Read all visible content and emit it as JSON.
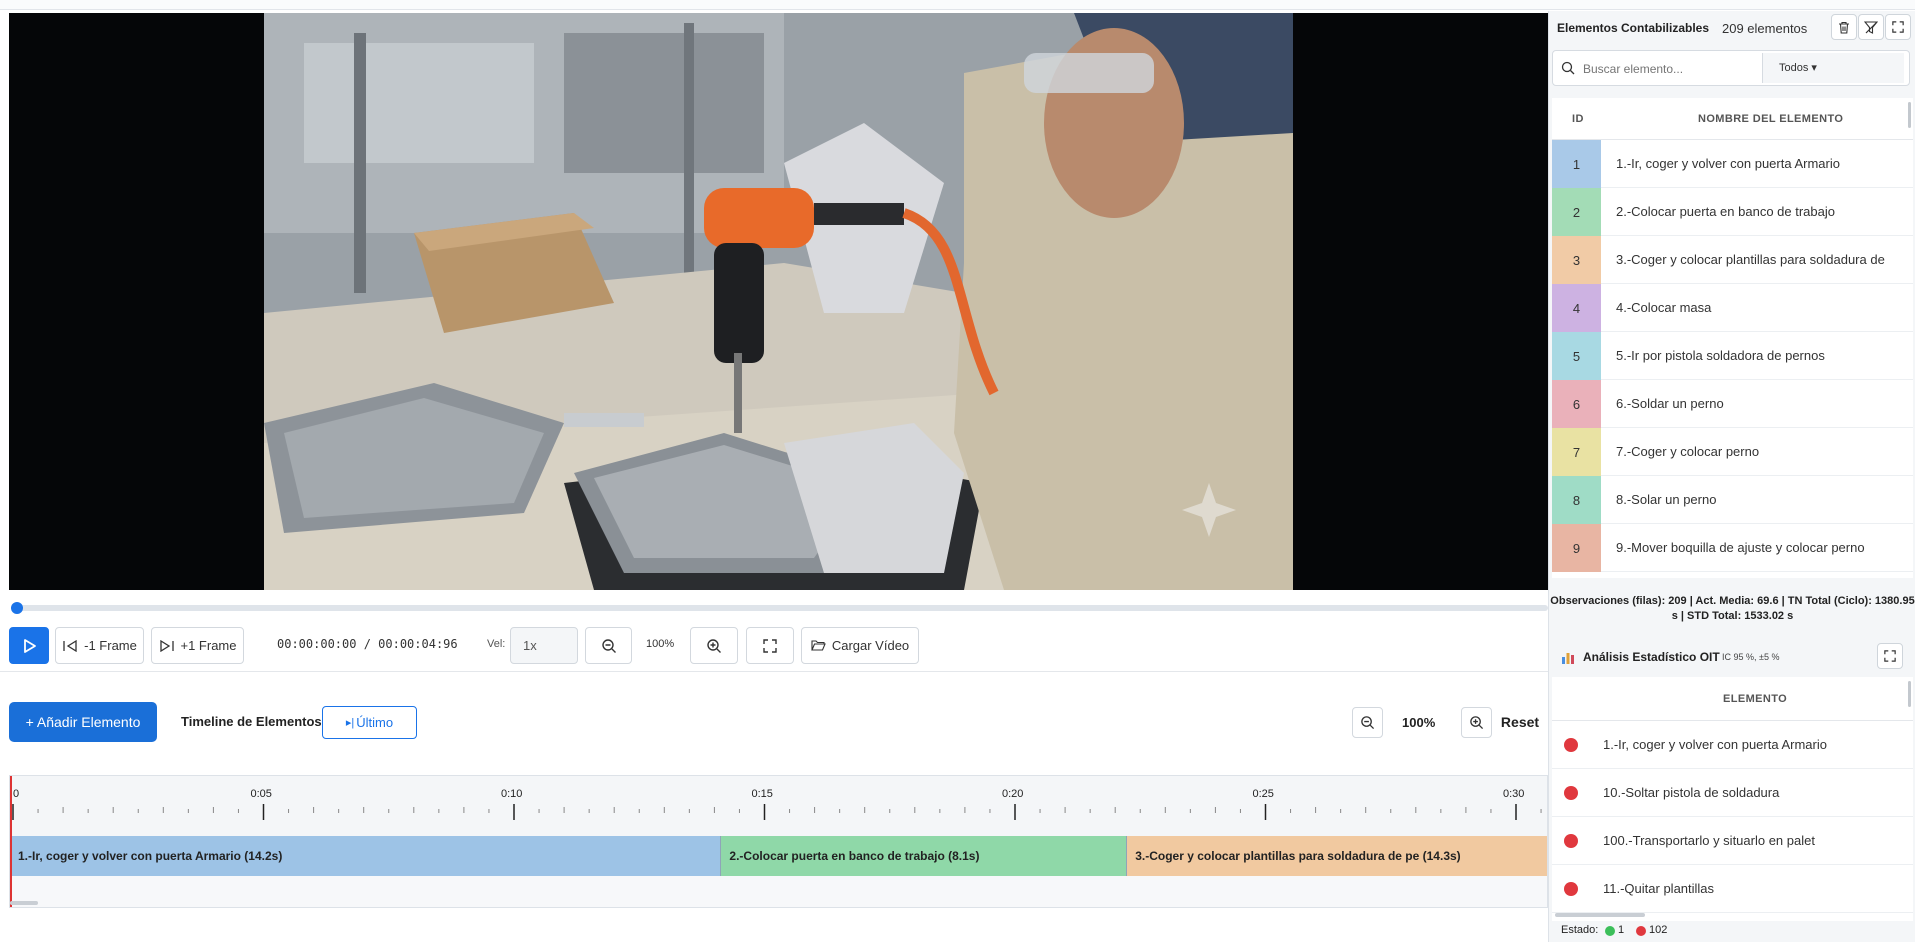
{
  "video": {
    "controls": {
      "prev_frame_label": "-1 Frame",
      "next_frame_label": "+1 Frame",
      "timecode": "00:00:00:00 / 00:00:04:96",
      "speed_label": "Vel:",
      "speed_value": "1x",
      "zoom_value": "100%",
      "load_video_label": "Cargar Vídeo"
    }
  },
  "timeline": {
    "add_element_label": "+ Añadir Elemento",
    "title": "Timeline de Elementos",
    "last_label": "Último",
    "zoom_value": "100%",
    "reset_label": "Reset",
    "ruler_labels": [
      "0",
      "0:05",
      "0:10",
      "0:15",
      "0:20",
      "0:25",
      "0:30"
    ],
    "segments": [
      {
        "label": "1.-Ir, coger y volver con puerta Armario (14.2s)",
        "start_s": 0,
        "duration_s": 14.2,
        "color": "#9dc3e6"
      },
      {
        "label": "2.-Colocar puerta en banco de trabajo (8.1s)",
        "start_s": 14.2,
        "duration_s": 8.1,
        "color": "#8fd8a8"
      },
      {
        "label": "3.-Coger y colocar plantillas para soldadura de pe (14.3s)",
        "start_s": 22.3,
        "duration_s": 14.3,
        "color": "#f1c9a0"
      }
    ]
  },
  "elements_panel": {
    "title": "Elementos Contabilizables",
    "count_label": "209 elementos",
    "search_placeholder": "Buscar elemento...",
    "filter_value": "Todos ▾",
    "col_id": "ID",
    "col_name": "NOMBRE DEL ELEMENTO",
    "rows": [
      {
        "id": "1",
        "name": "1.-Ir, coger y volver con puerta Armario",
        "color": "#a9c9e8"
      },
      {
        "id": "2",
        "name": "2.-Colocar puerta en banco de trabajo",
        "color": "#a3dcb6"
      },
      {
        "id": "3",
        "name": "3.-Coger y colocar plantillas para soldadura de",
        "color": "#f1cba6"
      },
      {
        "id": "4",
        "name": "4.-Colocar masa",
        "color": "#cdb2e2"
      },
      {
        "id": "5",
        "name": "5.-Ir por pistola soldadora de pernos",
        "color": "#a8d9e3"
      },
      {
        "id": "6",
        "name": "6.-Soldar un perno",
        "color": "#eab1ba"
      },
      {
        "id": "7",
        "name": "7.-Coger y colocar perno",
        "color": "#e9e2a3"
      },
      {
        "id": "8",
        "name": "8.-Solar un perno",
        "color": "#9fdcc6"
      },
      {
        "id": "9",
        "name": "9.-Mover boquilla de ajuste y colocar perno",
        "color": "#e8b5a3"
      }
    ],
    "summary": "Observaciones (filas): 209  |  Act. Media: 69.6  |  TN Total (Ciclo): 1380.95 s  |  STD Total: 1533.02 s"
  },
  "stats_panel": {
    "title": "Análisis Estadístico OIT",
    "subtitle": "IC 95 %, ±5 %",
    "col_element": "ELEMENTO",
    "rows": [
      {
        "name": "1.-Ir, coger y volver con puerta Armario"
      },
      {
        "name": "10.-Soltar pistola de soldadura"
      },
      {
        "name": "100.-Transportarlo y situarlo en palet"
      },
      {
        "name": "11.-Quitar plantillas"
      }
    ]
  },
  "status": {
    "label": "Estado:",
    "green_count": "1",
    "red_count": "102",
    "green_color": "#3cbf5a",
    "red_color": "#e0383e"
  }
}
